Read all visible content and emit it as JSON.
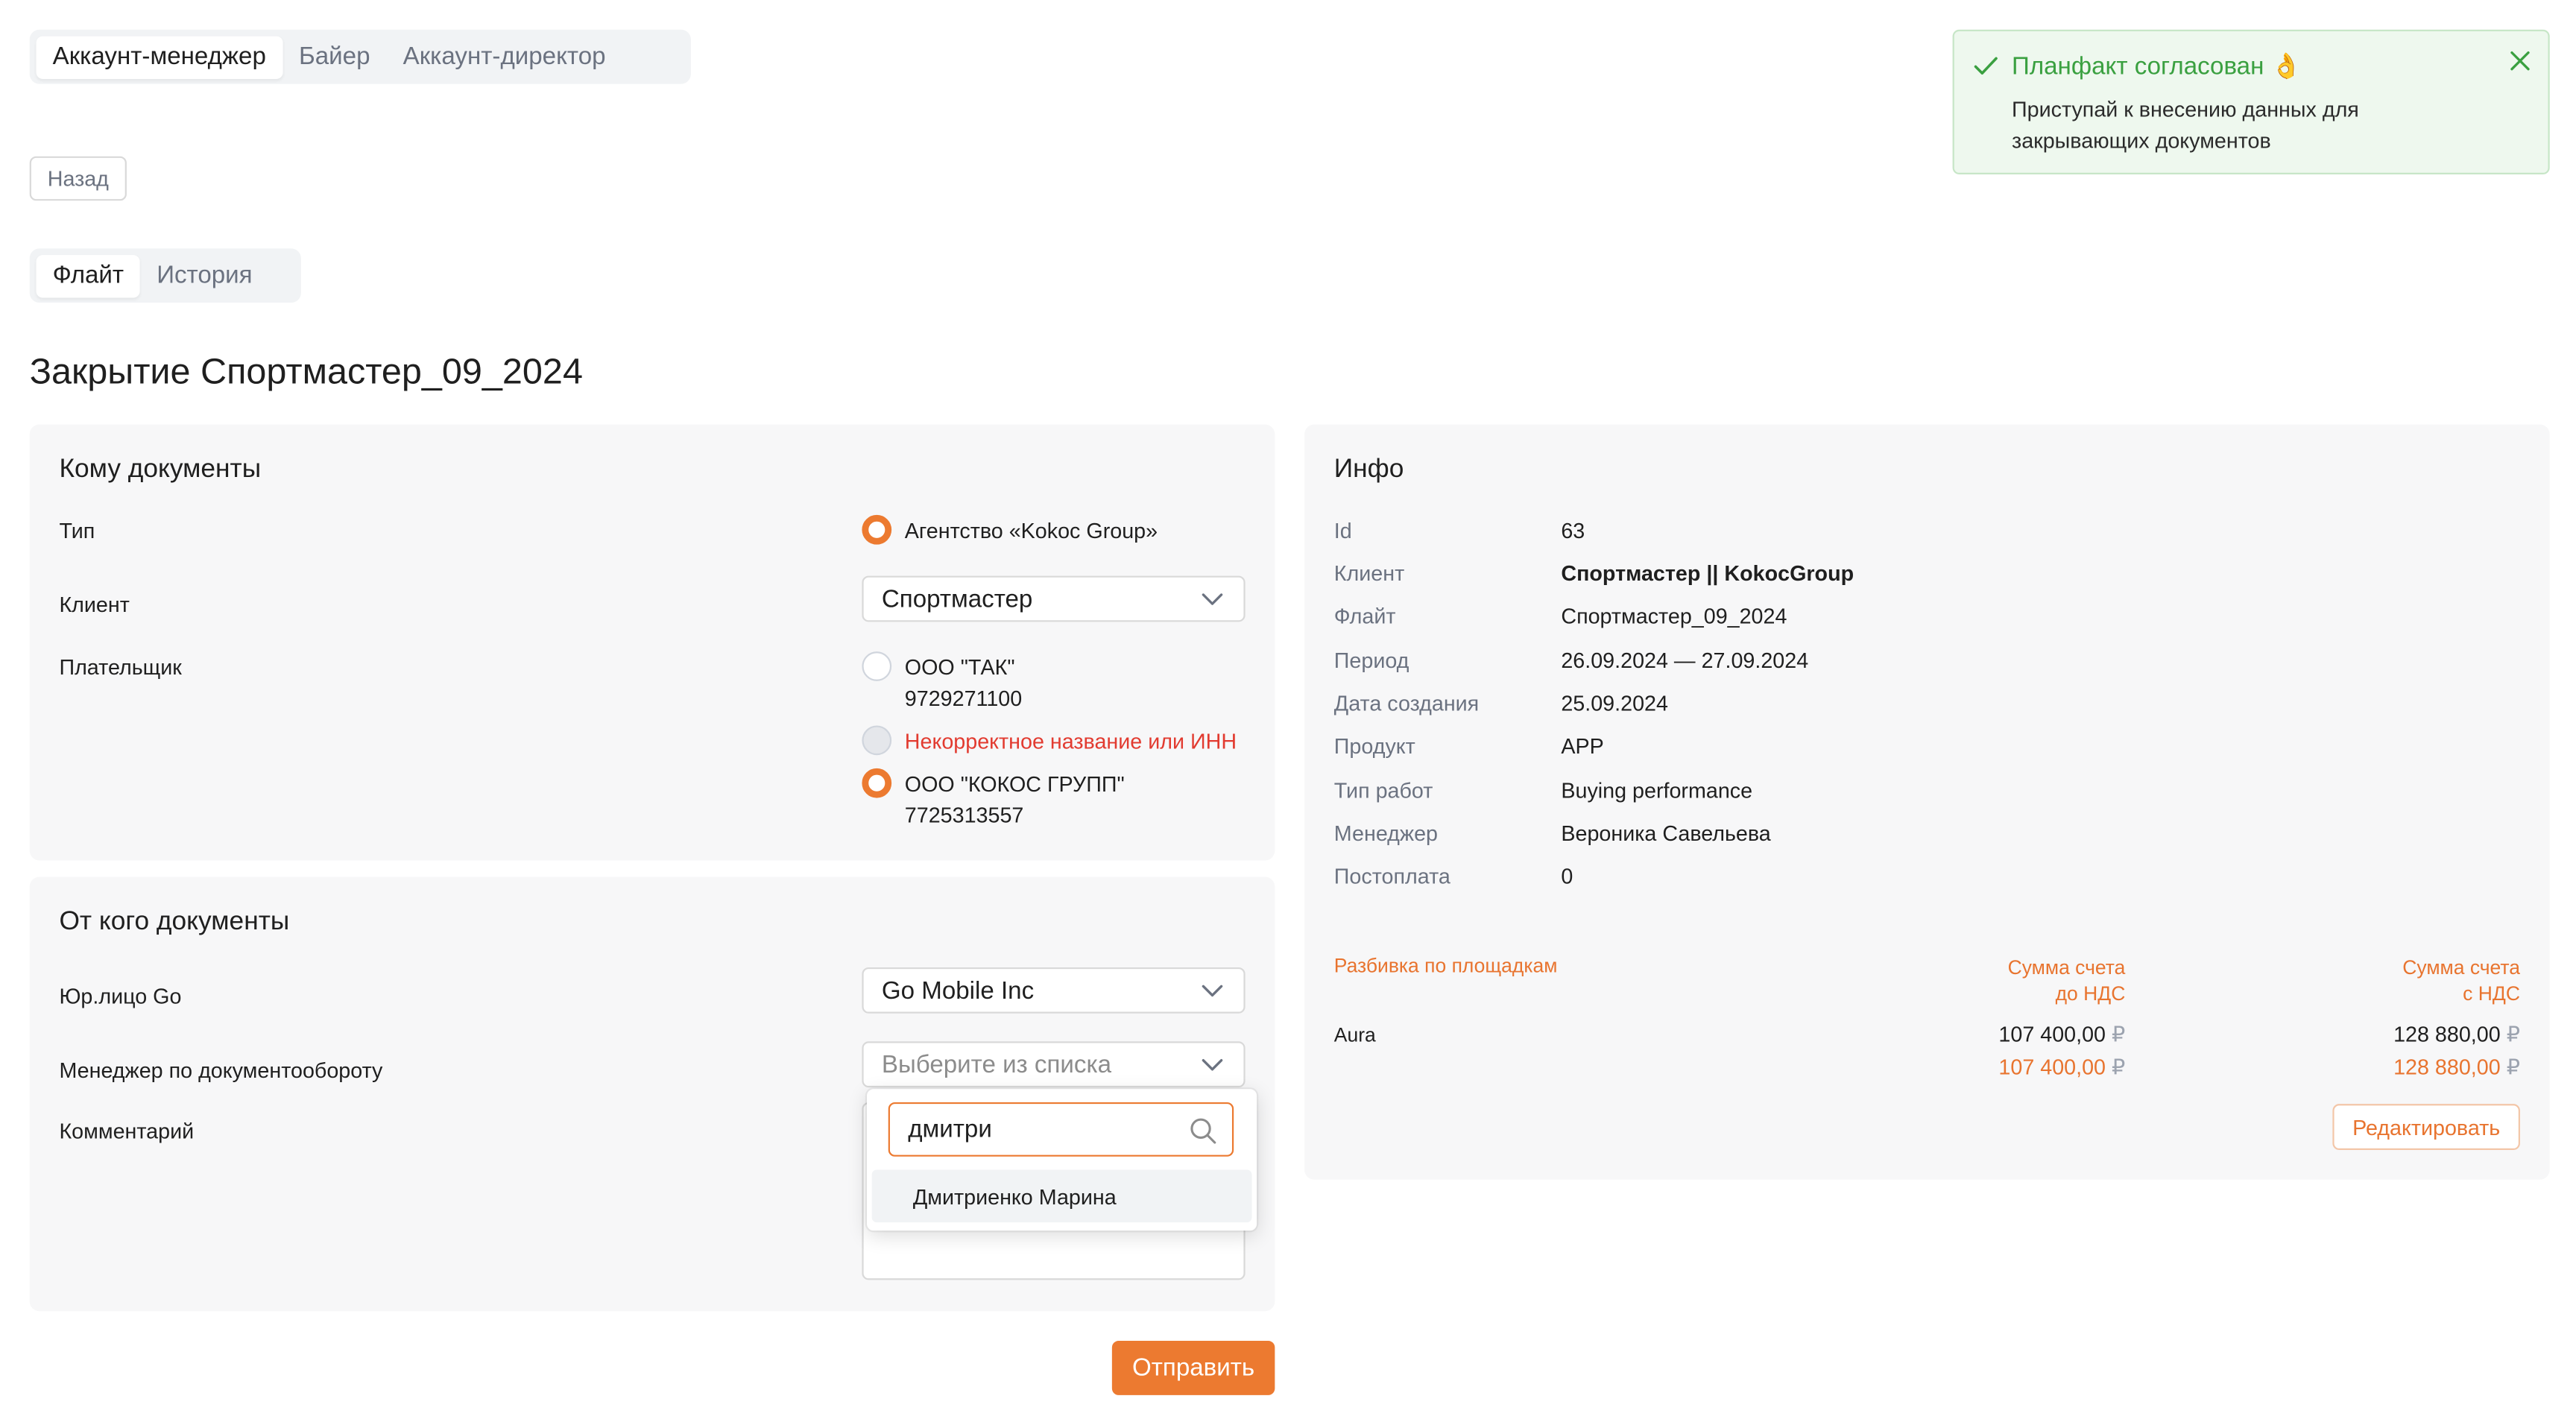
{
  "role_tabs": [
    {
      "label": "Аккаунт-менеджер",
      "active": true
    },
    {
      "label": "Байер",
      "active": false
    },
    {
      "label": "Аккаунт-директор",
      "active": false
    }
  ],
  "back_label": "Назад",
  "view_tabs": [
    {
      "label": "Флайт",
      "active": true
    },
    {
      "label": "История",
      "active": false
    }
  ],
  "page_title": "Закрытие Спортмастер_09_2024",
  "to_section": {
    "title": "Кому документы",
    "type_label": "Тип",
    "type_option": "Агентство «Kokoc Group»",
    "client_label": "Клиент",
    "client_value": "Спортмастер",
    "payer_label": "Плательщик",
    "payers": [
      {
        "name": "ООО \"ТАК\"",
        "inn": "9729271100",
        "selected": false
      },
      {
        "name": "Некорректное название или ИНН",
        "inn": "",
        "error": true,
        "disabled": true
      },
      {
        "name": "ООО \"КОКОС ГРУПП\"",
        "inn": "7725313557",
        "selected": true
      }
    ]
  },
  "from_section": {
    "title": "От кого документы",
    "entity_label": "Юр.лицо Go",
    "entity_value": "Go Mobile Inc",
    "manager_label": "Менеджер по документообороту",
    "manager_placeholder": "Выберите из списка",
    "comment_label": "Комментарий",
    "search_value": "дмитри",
    "options": [
      "Дмитриенко Марина"
    ]
  },
  "submit_label": "Отправить",
  "info": {
    "title": "Инфо",
    "rows": [
      {
        "label": "Id",
        "value": "63"
      },
      {
        "label": "Клиент",
        "value": "Спортмастер || KokocGroup"
      },
      {
        "label": "Флайт",
        "value": "Спортмастер_09_2024"
      },
      {
        "label": "Период",
        "value": "26.09.2024 — 27.09.2024"
      },
      {
        "label": "Дата создания",
        "value": "25.09.2024"
      },
      {
        "label": "Продукт",
        "value": "APP"
      },
      {
        "label": "Тип работ",
        "value": "Buying performance"
      },
      {
        "label": "Менеджер",
        "value": "Вероника Савельева"
      },
      {
        "label": "Постоплата",
        "value": "0"
      }
    ],
    "breakdown": {
      "col_platform": "Разбивка по площадкам",
      "col_before_vat_1": "Сумма счета",
      "col_before_vat_2": "до НДС",
      "col_with_vat_1": "Сумма счета",
      "col_with_vat_2": "с НДС",
      "row_name": "Aura",
      "before_vat": "107 400,00",
      "before_vat_total": "107 400,00",
      "with_vat": "128 880,00",
      "with_vat_total": "128 880,00",
      "currency": "₽"
    },
    "edit_label": "Редактировать"
  },
  "toast": {
    "title": "Планфакт согласован 👌",
    "body_line1": "Приступай к внесению данных для",
    "body_line2": "закрывающих документов"
  },
  "colors": {
    "accent": "#ec7a30",
    "success": "#3aa040",
    "error": "#e23b30"
  }
}
